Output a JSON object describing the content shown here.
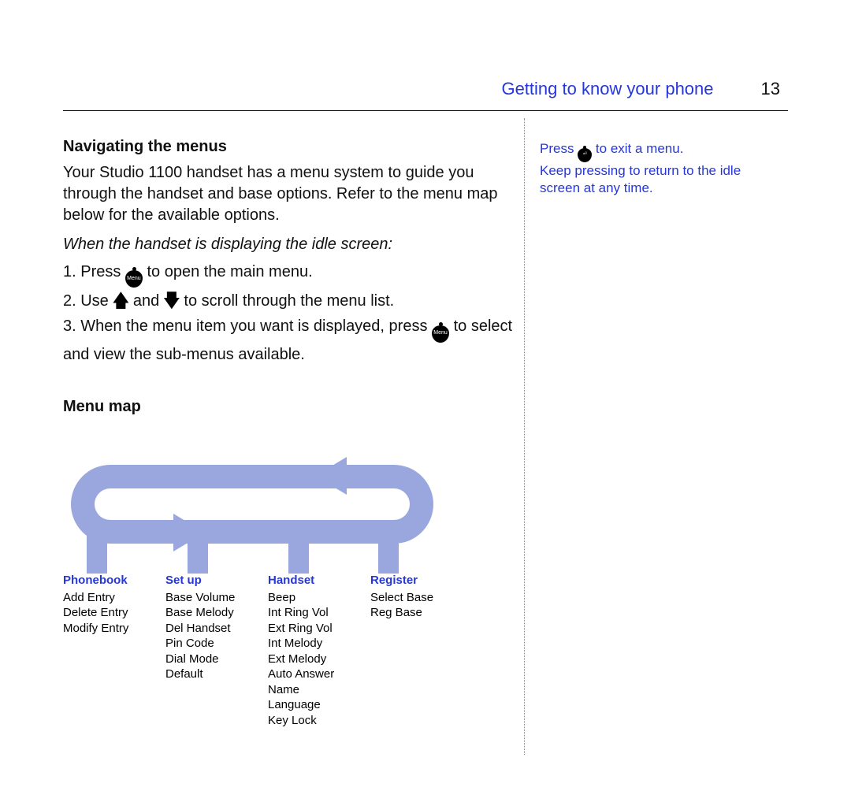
{
  "header": {
    "section_title": "Getting to know your phone",
    "page_number": "13"
  },
  "main": {
    "nav_heading": "Navigating the menus",
    "intro": "Your Studio 1100 handset has a menu system to guide you through the handset and base options. Refer to the menu map below for the available options.",
    "when_idle": "When the handset is displaying the idle screen:",
    "step1_a": "1. Press ",
    "step1_b": " to open the main menu.",
    "step2_a": "2. Use ",
    "step2_and": " and ",
    "step2_b": " to scroll through the menu list.",
    "step3_a": "3. When the menu item you want is displayed, press ",
    "step3_b": " to select and view the sub-menus available.",
    "menu_map_heading": "Menu map",
    "icon_menu_label": "Menu"
  },
  "side": {
    "line1_a": "Press ",
    "line1_b": " to exit a menu.",
    "line2": "Keep pressing to return to the idle screen at any time."
  },
  "menu_map": {
    "columns": [
      {
        "title": "Phonebook",
        "items": [
          "Add Entry",
          "Delete Entry",
          "Modify Entry"
        ]
      },
      {
        "title": "Set up",
        "items": [
          "Base Volume",
          "Base Melody",
          "Del Handset",
          "Pin Code",
          "Dial Mode",
          "Default"
        ]
      },
      {
        "title": "Handset",
        "items": [
          "Beep",
          "Int Ring Vol",
          "Ext Ring Vol",
          "Int Melody",
          "Ext Melody",
          "Auto Answer",
          "Name",
          "Language",
          "Key Lock"
        ]
      },
      {
        "title": "Register",
        "items": [
          "Select Base",
          "Reg Base"
        ]
      }
    ]
  }
}
